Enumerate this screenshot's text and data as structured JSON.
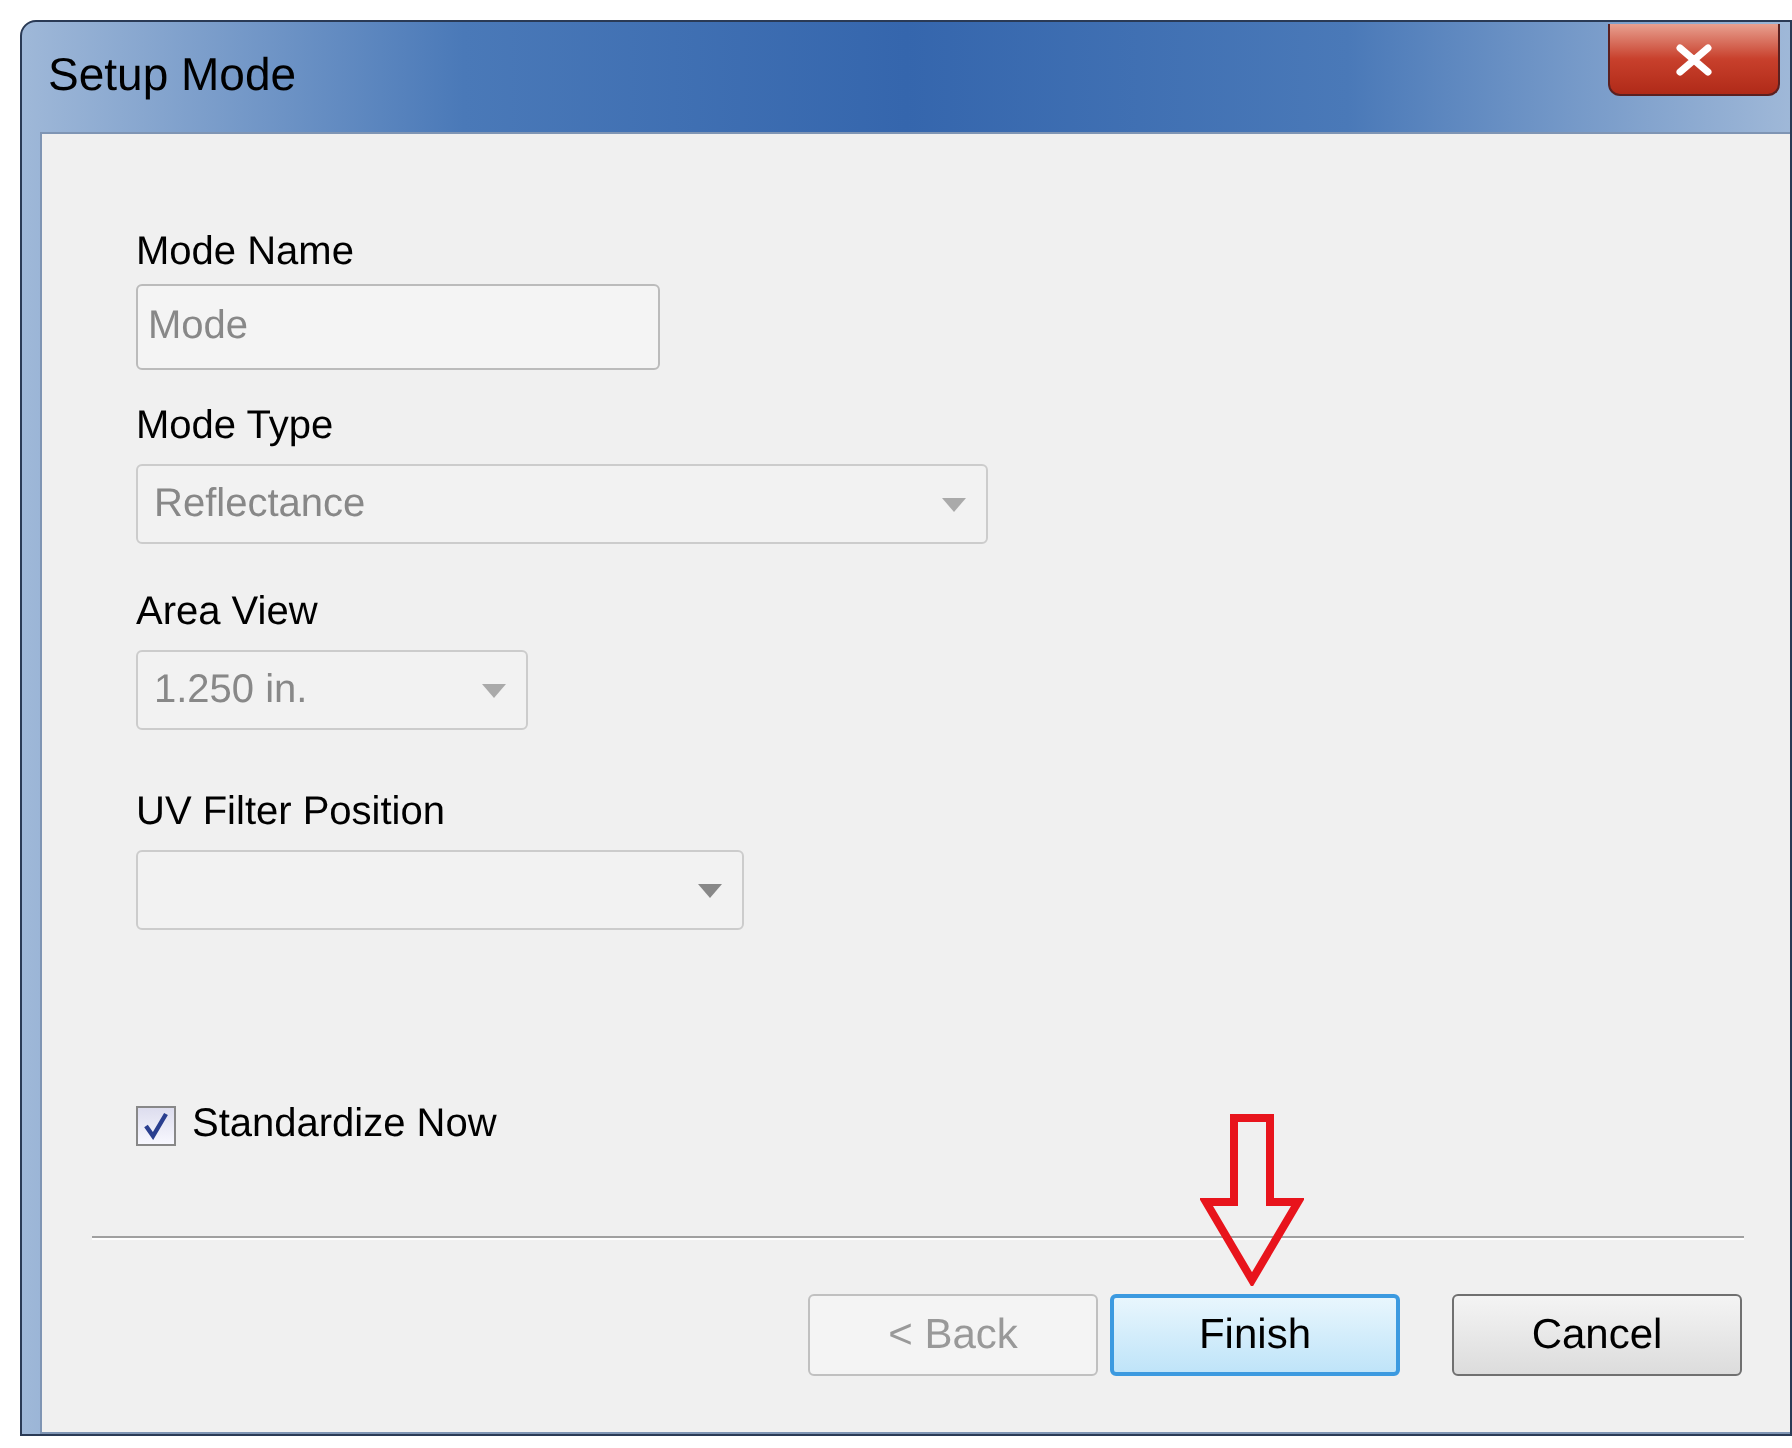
{
  "window": {
    "title": "Setup Mode"
  },
  "fields": [
    {
      "kind": "text",
      "label": "Mode Name",
      "value": "Mode",
      "disabled": true
    },
    {
      "kind": "combo",
      "label": "Mode Type",
      "value": "Reflectance",
      "disabled": true
    },
    {
      "kind": "combo",
      "label": "Area View",
      "value": "1.250 in.",
      "disabled": true
    },
    {
      "kind": "combo",
      "label": "UV Filter Position",
      "disabled": false
    }
  ],
  "checkbox": {
    "label": "Standardize Now",
    "checked": true
  },
  "buttons": [
    {
      "label": "< Back",
      "disabled": true,
      "default": false
    },
    {
      "label": "Finish",
      "disabled": false,
      "default": true
    },
    {
      "label": "Cancel",
      "disabled": false,
      "default": false
    }
  ]
}
